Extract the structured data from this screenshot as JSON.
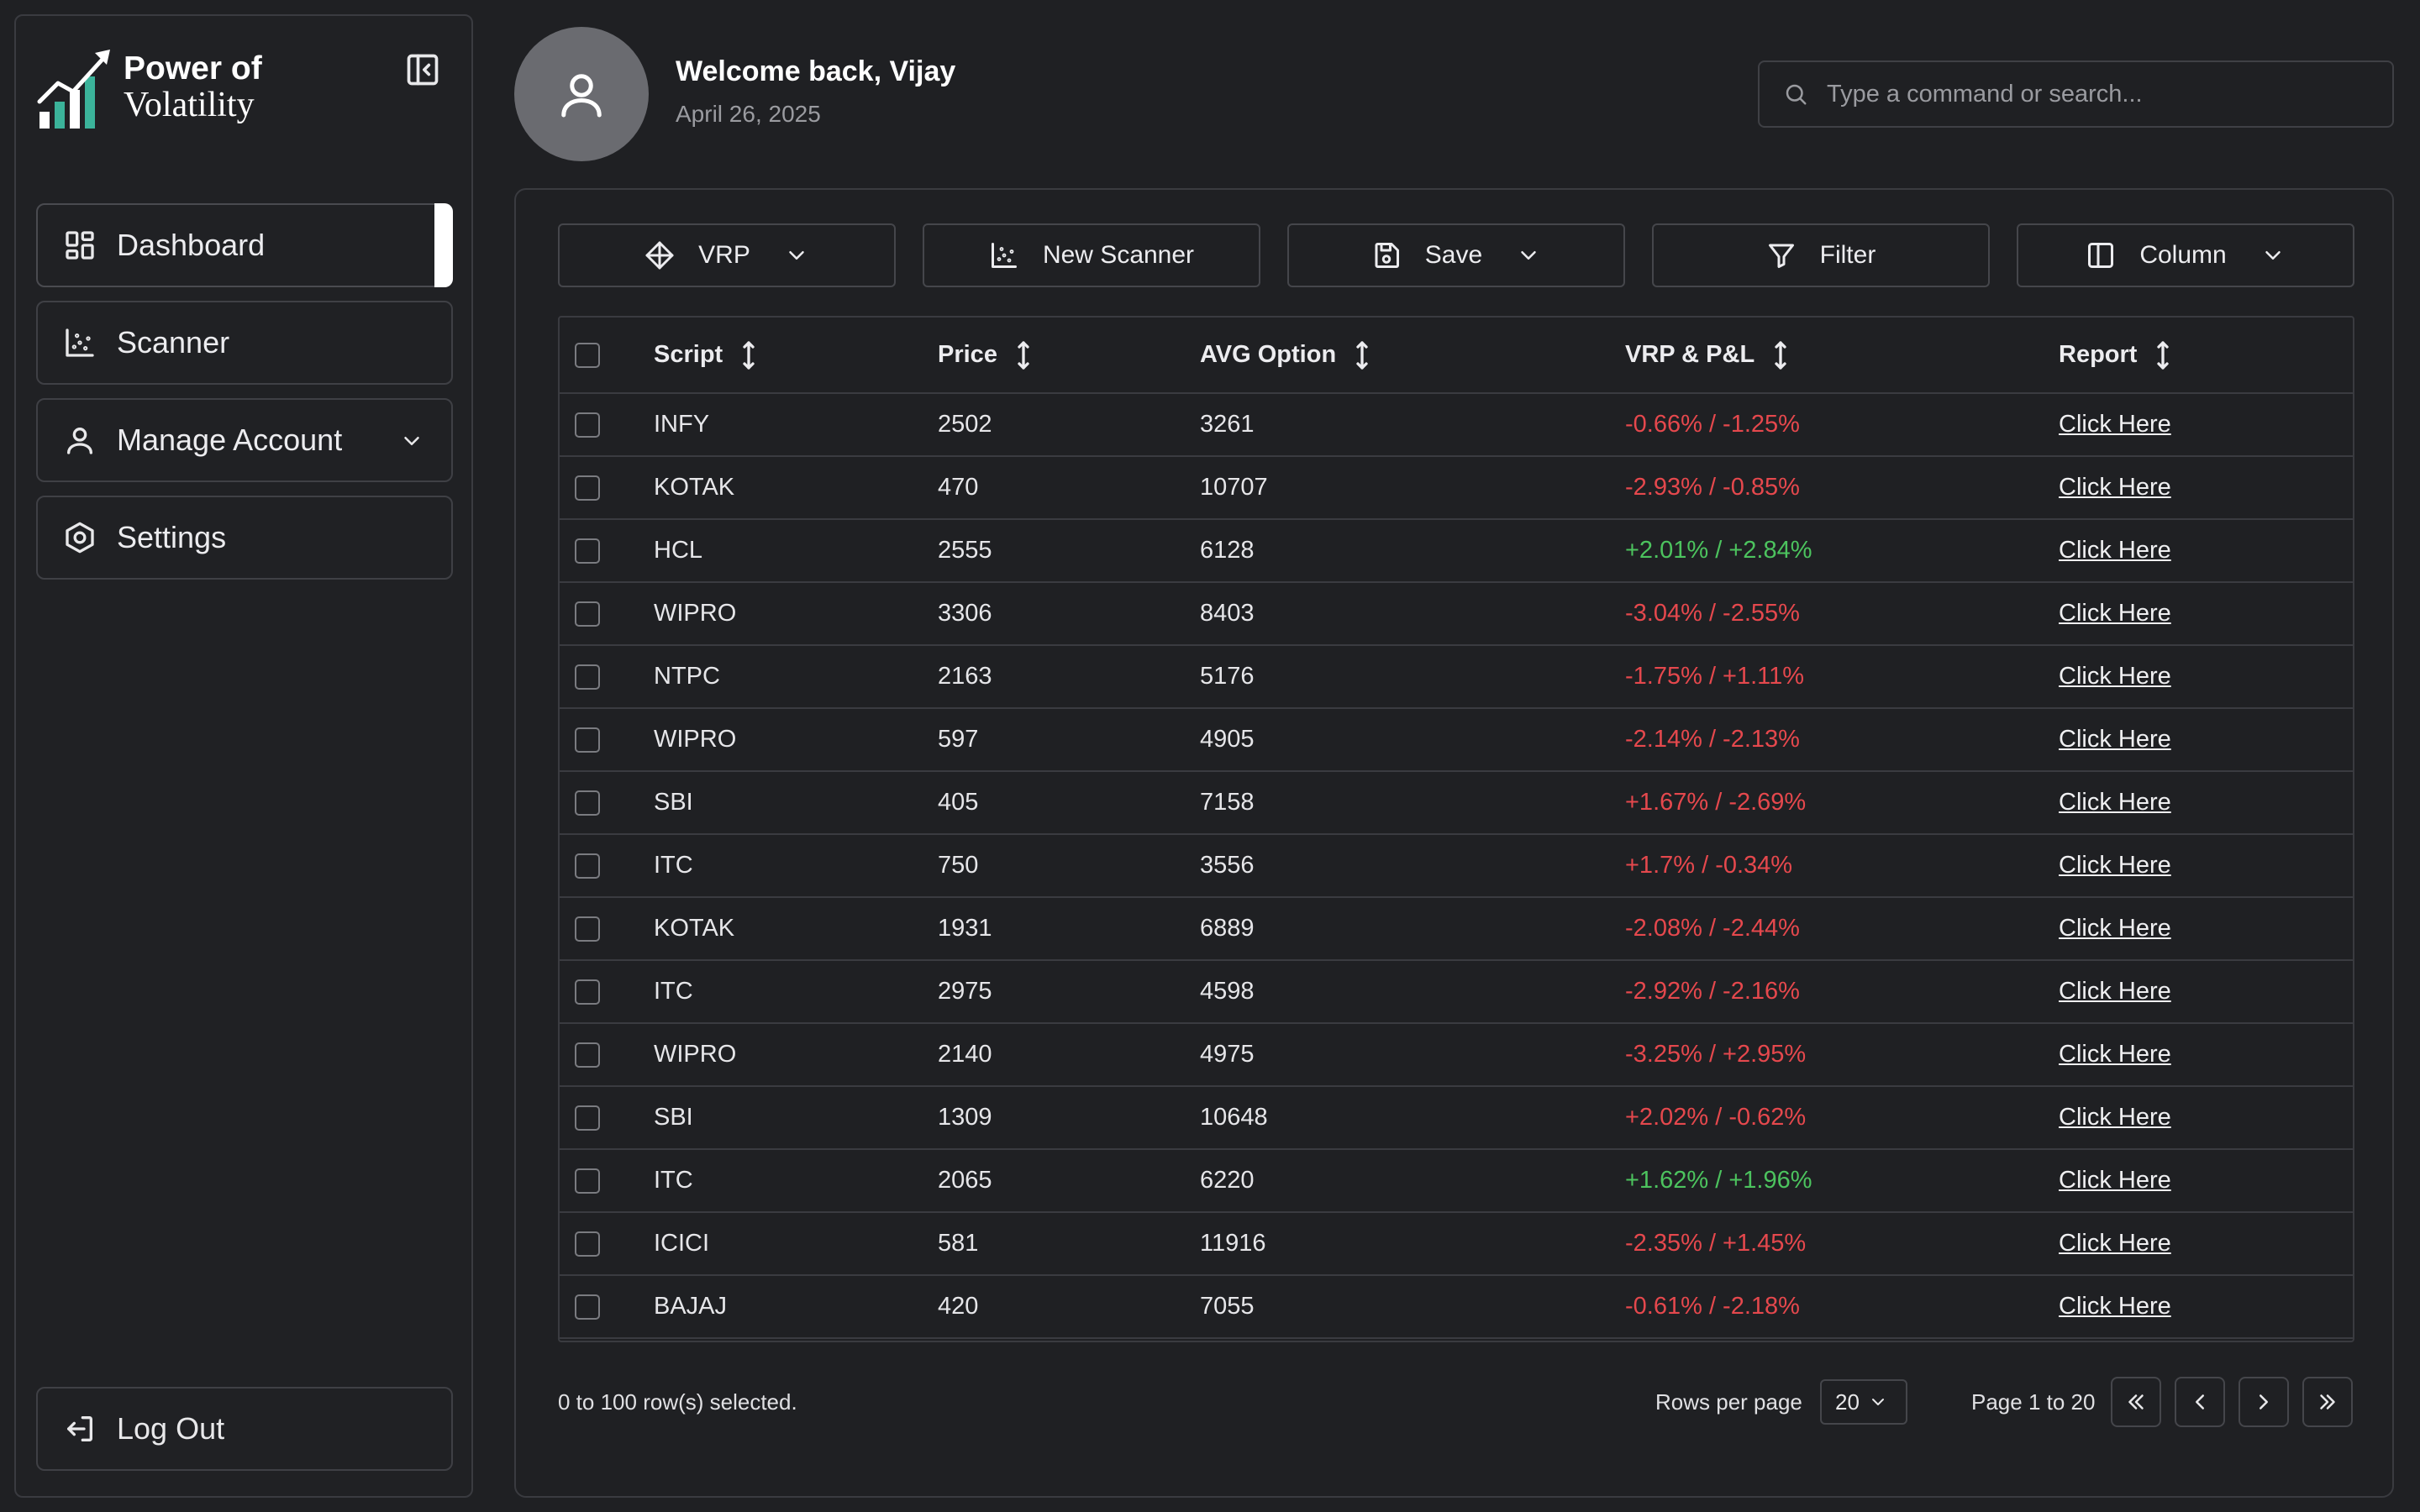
{
  "app": {
    "logo_line1": "Power of",
    "logo_line2": "Volatility"
  },
  "sidebar": {
    "items": [
      {
        "label": "Dashboard",
        "icon": "grid-icon"
      },
      {
        "label": "Scanner",
        "icon": "scatter-chart-icon"
      },
      {
        "label": "Manage Account",
        "icon": "user-icon"
      },
      {
        "label": "Settings",
        "icon": "hexagon-settings-icon"
      }
    ],
    "logout_label": "Log Out"
  },
  "header": {
    "welcome": "Welcome back, Vijay",
    "date": "April 26, 2025",
    "search_placeholder": "Type a command or search..."
  },
  "toolbar": {
    "vrp_label": "VRP",
    "new_scanner_label": "New Scanner",
    "save_label": "Save",
    "filter_label": "Filter",
    "column_label": "Column"
  },
  "table": {
    "headers": {
      "script": "Script",
      "price": "Price",
      "avg_option": "AVG Option",
      "vrp_pl": "VRP & P&L",
      "report": "Report"
    },
    "rows": [
      {
        "script": "INFY",
        "price": "2502",
        "avg": "3261",
        "vrp": "-0.66% / -1.25%",
        "tone": "neg",
        "report": "Click Here"
      },
      {
        "script": "KOTAK",
        "price": "470",
        "avg": "10707",
        "vrp": "-2.93% / -0.85%",
        "tone": "neg",
        "report": "Click Here"
      },
      {
        "script": "HCL",
        "price": "2555",
        "avg": "6128",
        "vrp": "+2.01% / +2.84%",
        "tone": "pos",
        "report": "Click Here"
      },
      {
        "script": "WIPRO",
        "price": "3306",
        "avg": "8403",
        "vrp": "-3.04% / -2.55%",
        "tone": "neg",
        "report": "Click Here"
      },
      {
        "script": "NTPC",
        "price": "2163",
        "avg": "5176",
        "vrp": "-1.75% / +1.11%",
        "tone": "neg",
        "report": "Click Here"
      },
      {
        "script": "WIPRO",
        "price": "597",
        "avg": "4905",
        "vrp": "-2.14% / -2.13%",
        "tone": "neg",
        "report": "Click Here"
      },
      {
        "script": "SBI",
        "price": "405",
        "avg": "7158",
        "vrp": "+1.67% / -2.69%",
        "tone": "neg",
        "report": "Click Here"
      },
      {
        "script": "ITC",
        "price": "750",
        "avg": "3556",
        "vrp": "+1.7% / -0.34%",
        "tone": "neg",
        "report": "Click Here"
      },
      {
        "script": "KOTAK",
        "price": "1931",
        "avg": "6889",
        "vrp": "-2.08% / -2.44%",
        "tone": "neg",
        "report": "Click Here"
      },
      {
        "script": "ITC",
        "price": "2975",
        "avg": "4598",
        "vrp": "-2.92% / -2.16%",
        "tone": "neg",
        "report": "Click Here"
      },
      {
        "script": "WIPRO",
        "price": "2140",
        "avg": "4975",
        "vrp": "-3.25% / +2.95%",
        "tone": "neg",
        "report": "Click Here"
      },
      {
        "script": "SBI",
        "price": "1309",
        "avg": "10648",
        "vrp": "+2.02% / -0.62%",
        "tone": "neg",
        "report": "Click Here"
      },
      {
        "script": "ITC",
        "price": "2065",
        "avg": "6220",
        "vrp": "+1.62% / +1.96%",
        "tone": "pos",
        "report": "Click Here"
      },
      {
        "script": "ICICI",
        "price": "581",
        "avg": "11916",
        "vrp": "-2.35% / +1.45%",
        "tone": "neg",
        "report": "Click Here"
      },
      {
        "script": "BAJAJ",
        "price": "420",
        "avg": "7055",
        "vrp": "-0.61% / -2.18%",
        "tone": "neg",
        "report": "Click Here"
      }
    ]
  },
  "footer": {
    "selected_text": "0 to 100 row(s) selected.",
    "rows_per_page_label": "Rows per page",
    "rows_per_page_value": "20",
    "page_label": "Page 1 to 20"
  },
  "colors": {
    "background": "#1f2023",
    "negative": "#e5484d",
    "positive": "#4cc35e",
    "accent": "#ffffff"
  }
}
